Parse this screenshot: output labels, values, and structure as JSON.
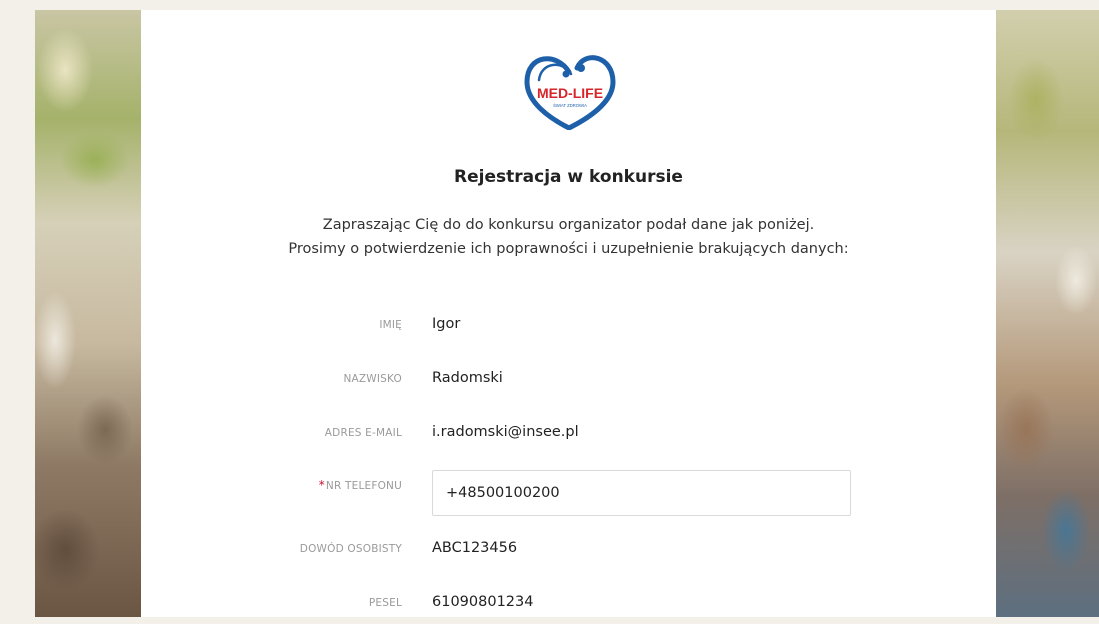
{
  "logo": {
    "name": "MED-LIFE",
    "tagline": "ŚWIAT ZDROWIA"
  },
  "title": "Rejestracja w konkursie",
  "intro": [
    "Zapraszając Cię do do konkursu organizator podał dane jak poniżej.",
    "Prosimy o potwierdzenie ich poprawności i uzupełnienie brakujących danych:"
  ],
  "fields": {
    "first_name": {
      "label": "IMIĘ",
      "value": "Igor"
    },
    "last_name": {
      "label": "NAZWISKO",
      "value": "Radomski"
    },
    "email": {
      "label": "ADRES E-MAIL",
      "value": "i.radomski@insee.pl"
    },
    "phone": {
      "required_mark": "*",
      "label": "NR TELEFONU",
      "value": "+48500100200"
    },
    "id_card": {
      "label": "DOWÓD OSOBISTY",
      "value": "ABC123456"
    },
    "pesel": {
      "label": "PESEL",
      "value": "61090801234"
    }
  },
  "colors": {
    "brand_blue": "#1d5fa8",
    "brand_red": "#d7262b",
    "required": "#c8102e"
  }
}
